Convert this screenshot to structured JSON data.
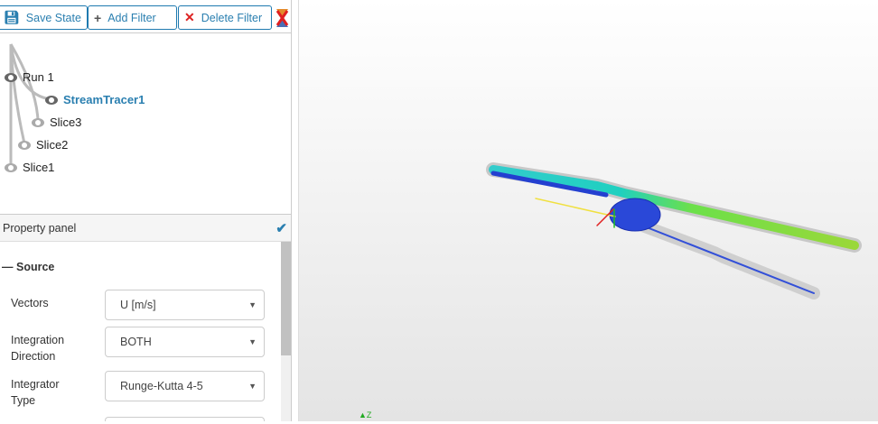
{
  "toolbar": {
    "save_state": "Save State",
    "add_filter": "Add Filter",
    "delete_filter": "Delete Filter"
  },
  "tree": [
    {
      "label": "Run 1"
    },
    {
      "label": "StreamTracer1",
      "selected": true
    },
    {
      "label": "Slice3"
    },
    {
      "label": "Slice2"
    },
    {
      "label": "Slice1"
    }
  ],
  "property_panel": {
    "title": "Property panel",
    "section": "Source",
    "fields": [
      {
        "label": "Vectors",
        "value": "U [m/s]"
      },
      {
        "label": "Integration Direction",
        "value": "BOTH"
      },
      {
        "label": "Integrator Type",
        "value": "Runge-Kutta 4-5"
      }
    ]
  },
  "viewport": {
    "axis_label": "Z"
  },
  "colors": {
    "accent": "#2a7fb0",
    "selected": "#2a7fb0"
  }
}
